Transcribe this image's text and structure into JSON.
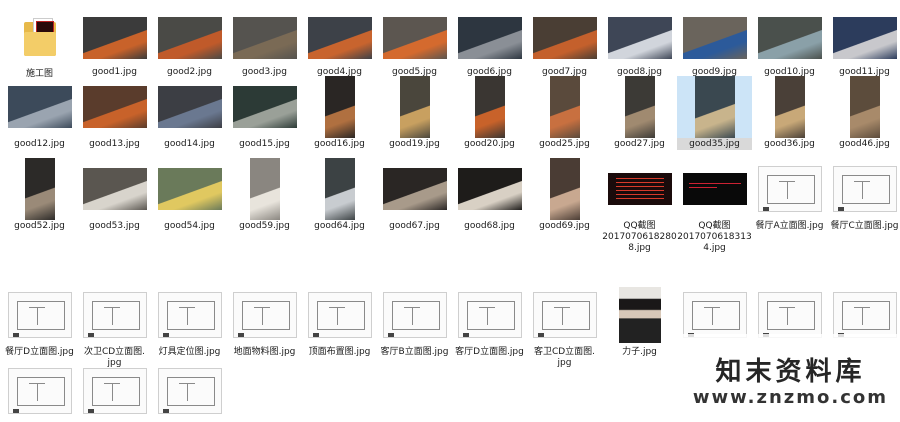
{
  "folder": {
    "label": "施工图",
    "icon": "folder-icon"
  },
  "row1": [
    {
      "label": "good1.jpg",
      "c1": "#3b3b3b",
      "c2": "#c8622a"
    },
    {
      "label": "good2.jpg",
      "c1": "#4a4a46",
      "c2": "#c05a2a"
    },
    {
      "label": "good3.jpg",
      "c1": "#55534f",
      "c2": "#7a6a55"
    },
    {
      "label": "good4.jpg",
      "c1": "#3d4148",
      "c2": "#c8642e"
    },
    {
      "label": "good5.jpg",
      "c1": "#5c5650",
      "c2": "#d46a2e"
    },
    {
      "label": "good6.jpg",
      "c1": "#2d3640",
      "c2": "#8a8f96"
    },
    {
      "label": "good7.jpg",
      "c1": "#4a3e34",
      "c2": "#c4602c"
    },
    {
      "label": "good8.jpg",
      "c1": "#3e4656",
      "c2": "#d1d5dc"
    },
    {
      "label": "good9.jpg",
      "c1": "#6a645c",
      "c2": "#2c5a9a"
    },
    {
      "label": "good10.jpg",
      "c1": "#4a504c",
      "c2": "#8aa0a8"
    },
    {
      "label": "good11.jpg",
      "c1": "#2c3c5c",
      "c2": "#c8c8cc"
    }
  ],
  "row2": [
    {
      "label": "good12.jpg",
      "c1": "#3c4a5a",
      "c2": "#9aa4b0",
      "kind": "land"
    },
    {
      "label": "good13.jpg",
      "c1": "#5a3c2c",
      "c2": "#c8622a",
      "kind": "land"
    },
    {
      "label": "good14.jpg",
      "c1": "#3c3e44",
      "c2": "#6a7890",
      "kind": "land"
    },
    {
      "label": "good15.jpg",
      "c1": "#2c3a36",
      "c2": "#9aa098",
      "kind": "land"
    },
    {
      "label": "good16.jpg",
      "c1": "#2a2624",
      "c2": "#b07040",
      "kind": "port"
    },
    {
      "label": "good19.jpg",
      "c1": "#4a463c",
      "c2": "#c8a060",
      "kind": "port"
    },
    {
      "label": "good20.jpg",
      "c1": "#3a3632",
      "c2": "#c8622a",
      "kind": "port"
    },
    {
      "label": "good25.jpg",
      "c1": "#5a4a3c",
      "c2": "#c87040",
      "kind": "port"
    },
    {
      "label": "good27.jpg",
      "c1": "#3c3a36",
      "c2": "#a08a70",
      "kind": "port"
    },
    {
      "label": "good35.jpg",
      "c1": "#3a4850",
      "c2": "#c8b48c",
      "kind": "sq",
      "selected": true
    },
    {
      "label": "good36.jpg",
      "c1": "#4a4038",
      "c2": "#c8a878",
      "kind": "port"
    },
    {
      "label": "good46.jpg",
      "c1": "#5c4c3c",
      "c2": "#a88a6a",
      "kind": "port"
    }
  ],
  "row3": [
    {
      "label": "good52.jpg",
      "c1": "#2c2a28",
      "c2": "#9a8a78",
      "kind": "port"
    },
    {
      "label": "good53.jpg",
      "c1": "#5a5650",
      "c2": "#d8d4cc",
      "kind": "land"
    },
    {
      "label": "good54.jpg",
      "c1": "#6a7a5a",
      "c2": "#e0c860",
      "kind": "land"
    },
    {
      "label": "good59.jpg",
      "c1": "#8a8680",
      "c2": "#e8e4dc",
      "kind": "port"
    },
    {
      "label": "good64.jpg",
      "c1": "#3c4244",
      "c2": "#c8ccd0",
      "kind": "port"
    },
    {
      "label": "good67.jpg",
      "c1": "#2a2624",
      "c2": "#a89a8a",
      "kind": "land"
    },
    {
      "label": "good68.jpg",
      "c1": "#1e1c1a",
      "c2": "#d8d0c4",
      "kind": "land"
    },
    {
      "label": "good69.jpg",
      "c1": "#4a3c34",
      "c2": "#c8a890",
      "kind": "port"
    },
    {
      "label": "QQ截图20170706182808.jpg",
      "display": "QQ截图\n20170706182808.jpg",
      "kind": "shot-red"
    },
    {
      "label": "QQ截图20170706183134.jpg",
      "display": "QQ截图\n20170706183134.jpg",
      "kind": "shot-blk"
    },
    {
      "label": "餐厅A立面图.jpg",
      "kind": "dwg"
    },
    {
      "label": "餐厅C立面图.jpg",
      "kind": "dwg"
    }
  ],
  "row4": [
    {
      "label": "餐厅D立面图.jpg",
      "kind": "dwg"
    },
    {
      "label": "次卫CD立面图.jpg",
      "display": "次卫CD立面图.\njpg",
      "kind": "dwg"
    },
    {
      "label": "灯具定位图.jpg",
      "kind": "dwg"
    },
    {
      "label": "地面物料图.jpg",
      "kind": "dwg"
    },
    {
      "label": "顶面布置图.jpg",
      "kind": "dwg"
    },
    {
      "label": "客厅B立面图.jpg",
      "kind": "dwg"
    },
    {
      "label": "客厅D立面图.jpg",
      "kind": "dwg"
    },
    {
      "label": "客卫CD立面图.jpg",
      "display": "客卫CD立面图.\njpg",
      "kind": "dwg"
    },
    {
      "label": "力子.jpg",
      "kind": "photo"
    },
    {
      "label": "",
      "kind": "dwg"
    },
    {
      "label": "",
      "kind": "dwg"
    },
    {
      "label": "",
      "kind": "dwg"
    }
  ],
  "row5": [
    {
      "label": "",
      "kind": "dwg"
    },
    {
      "label": "",
      "kind": "dwg"
    },
    {
      "label": "",
      "kind": "dwg"
    }
  ],
  "watermark": {
    "title": "知末资料库",
    "url": "www.znzmo.com"
  }
}
